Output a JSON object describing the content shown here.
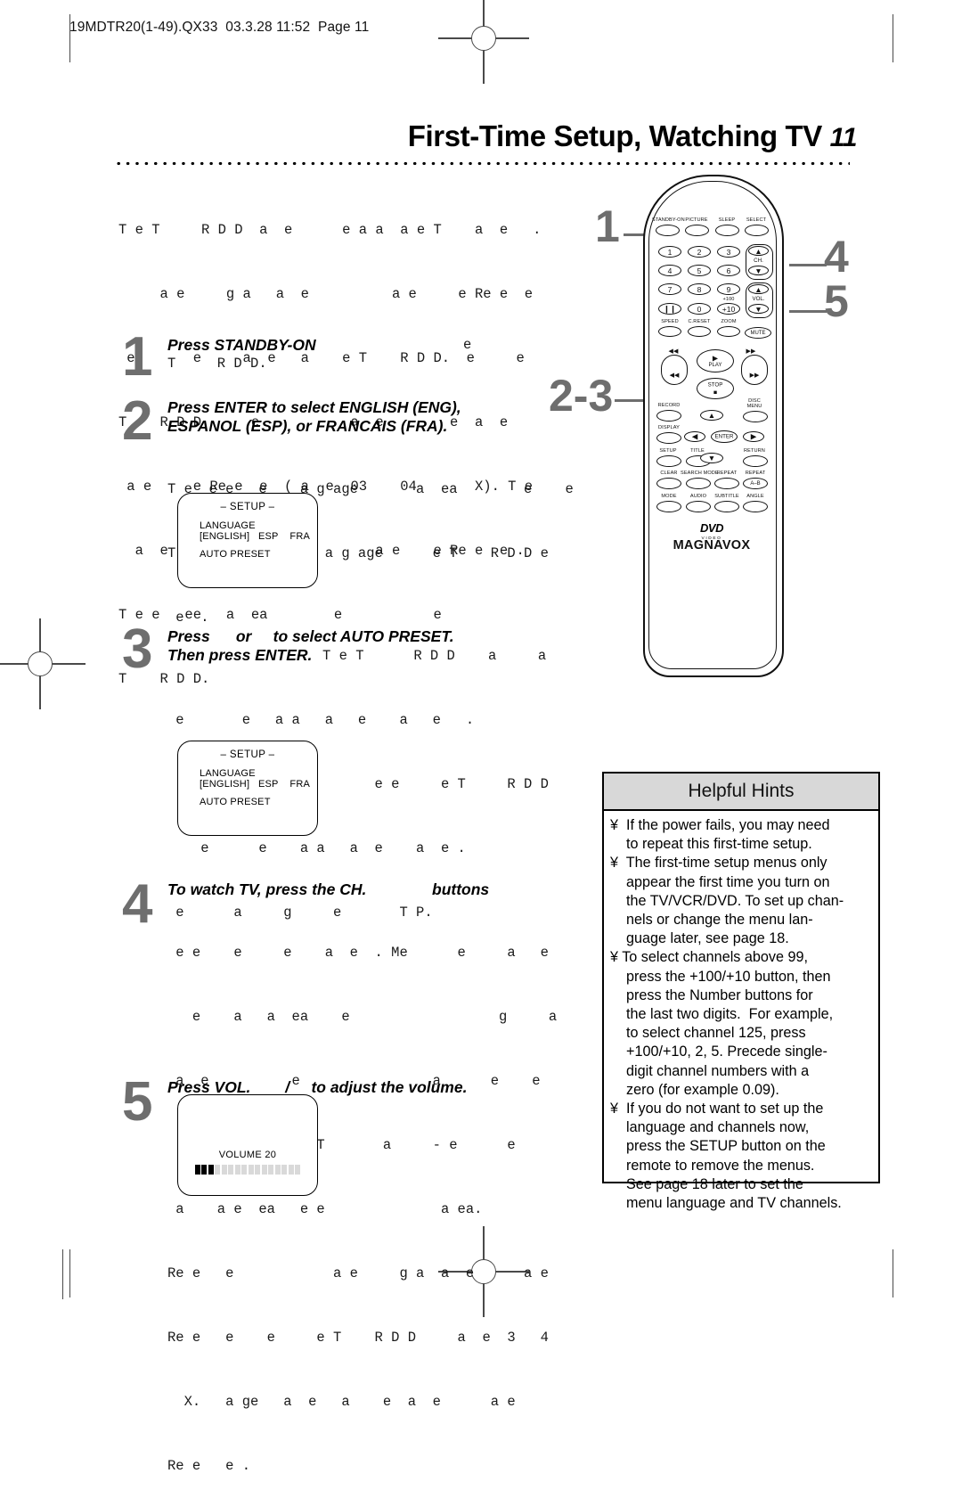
{
  "page": {
    "header": "19MDTR20(1-49).QX33  03.3.28 11:52  Page 11",
    "title": "First-Time Setup, Watching TV",
    "page_number": "11"
  },
  "intro_lines": [
    "T e T     R D D  a  e      e a a  a e T    a  e   .",
    "     a e     g a   a  e          a e     e Re e  e",
    " ee      e     a  e   a    e T    R D D.  e     e",
    "T    R D D      e           a  e        e  a  e",
    " a e     e Re e  e  ( a  e  03    04       X). T e",
    "  a  e   a     e  a  e         a e    e Re e  e .",
    "T e e   ee   a  ea        e           e",
    "T    R D D."
  ],
  "steps": [
    {
      "num": "1",
      "instruction": "Press STANDBY-ON",
      "instruction_tail": "e",
      "faded": [
        "T     R D D."
      ]
    },
    {
      "num": "2",
      "instruction_l1": "Press ENTER to select ENGLISH (ENG),",
      "instruction_l2": "ESPANOL (ESP), or FRANCAIS (FRA).",
      "faded": [
        "T e  e e   e    a g age       a  ea        e    e",
        "T          e   e   a g age      e T    R D D e",
        " e  ."
      ]
    },
    {
      "num": "3",
      "instruction_l1": "Press      or     to select AUTO PRESET.",
      "instruction_l2": "Then press ENTER.",
      "instruction_l2_tail": "T e T      R D D    a     a",
      "faded": [
        " e       e   a a   a   e    a   e   .",
        "  e      a     g         e e     e T     R D D",
        "    e      e    a a   a  e    a  e .",
        " e      a     g     e       T P."
      ]
    },
    {
      "num": "4",
      "instruction": "To watch TV, press the CH.",
      "instruction_tail": "buttons",
      "faded": [
        " e e    e     e    a  e  . Me      e     a   e",
        "   e    a   a  ea    e                  g     a",
        " a  e          e                a      e    e",
        "       e e      . T       a     - e      e",
        " a    a e  ea   e e              a ea.",
        "Re e   e            a e     g a  a  e      a e",
        "Re e   e    e     e T    R D D     a  e  3   4",
        "  X.   a ge   a  e   a    e  a  e      a e",
        "Re e   e ."
      ]
    },
    {
      "num": "5",
      "instruction": "Press VOL.        /     to adjust the volume."
    }
  ],
  "setup_menu": {
    "title": "– SETUP –",
    "line1": "LANGUAGE",
    "line2": "[ENGLISH]   ESP    FRA",
    "line3": "AUTO PRESET"
  },
  "volume_osd": {
    "label": "VOLUME    20",
    "total_cells": 16,
    "filled_cells": 3
  },
  "callouts": {
    "one": "1",
    "two_three": "2-3",
    "four": "4",
    "five": "5"
  },
  "hints": {
    "heading": "Helpful Hints",
    "lines": [
      "¥  If the power fails, you may need",
      "    to repeat this first-time setup.",
      "¥  The first-time setup menus only",
      "    appear the first time you turn on",
      "    the TV/VCR/DVD. To set up chan-",
      "    nels or change the menu lan-",
      "    guage later, see page 18.",
      "¥ To select channels above 99,",
      "    press the +100/+10 button, then",
      "    press the Number buttons for",
      "    the last two digits.  For example,",
      "    to select channel 125, press",
      "    +100/+10, 2, 5. Precede single-",
      "    digit channel numbers with a",
      "    zero (for example 0.09).",
      "¥  If you do not want to set up the",
      "    language and channels now,",
      "    press the SETUP button on the",
      "    remote to remove the menus.",
      "    See page 18 later to set the",
      "    menu language and TV channels."
    ]
  },
  "remote": {
    "brand": "MAGNAVOX",
    "logo": "DVD",
    "logo_sub": "VIDEO",
    "row_top": [
      "STANDBY-ON",
      "PICTURE",
      "SLEEP",
      "SELECT"
    ],
    "numbers": [
      "1",
      "2",
      "3",
      "4",
      "5",
      "6",
      "7",
      "8",
      "9"
    ],
    "bottom_numbers": [
      "❙❙",
      "0",
      "+10"
    ],
    "plus100": "+100",
    "ch_label": "CH.",
    "vol_label": "VOL.",
    "row_speed": [
      "SPEED",
      "C.RESET",
      "ZOOM"
    ],
    "mute": "MUTE",
    "transport": [
      "◀◀",
      "PLAY",
      "▶▶",
      "STOP"
    ],
    "transport_skip": [
      "◀◀",
      "▶▶"
    ],
    "play_label": "PLAY",
    "stop_label": "STOP",
    "record": "RECORD",
    "disc_menu_l1": "DISC",
    "disc_menu_l2": "MENU",
    "display": "DISPLAY",
    "enter": "ENTER",
    "setup": "SETUP",
    "title_btn": "TITLE",
    "return_btn": "RETURN",
    "row_clear": [
      "CLEAR",
      "SEARCH MODE",
      "REPEAT",
      "REPEAT"
    ],
    "repeat_ab": "A–B",
    "row_mode": [
      "MODE",
      "AUDIO",
      "SUBTITLE",
      "ANGLE"
    ]
  }
}
